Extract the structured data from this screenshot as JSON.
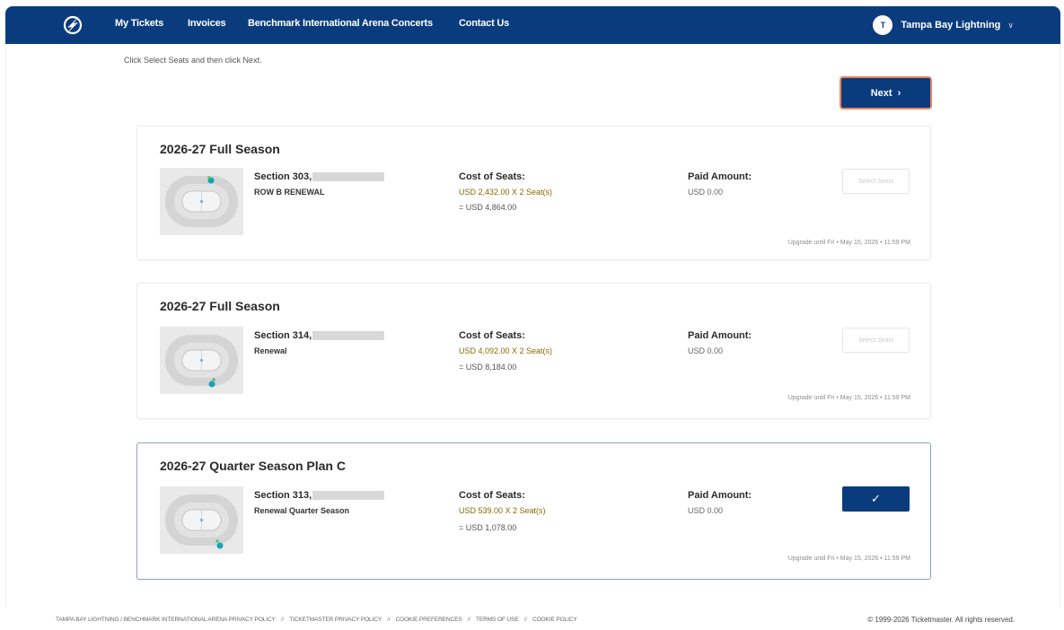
{
  "nav": {
    "items": [
      "My Tickets",
      "Invoices",
      "Benchmark International Arena Concerts",
      "Contact Us"
    ],
    "account_initial": "T",
    "account_name": "Tampa Bay Lightning"
  },
  "instruction": "Click Select Seats and then click Next.",
  "next_label": "Next",
  "labels": {
    "cost": "Cost of Seats:",
    "paid": "Paid Amount:",
    "select_seats": "Select Seats"
  },
  "cards": [
    {
      "title": "2026-27 Full Season",
      "section": "Section 303,",
      "row": "ROW B RENEWAL",
      "cost_line": "USD 2,432.00 X 2 Seat(s)",
      "total_line": "= USD 4,864.00",
      "paid_amount": "USD 0.00",
      "upgrade": "Upgrade until Fri • May 15, 2026 • 11:59 PM",
      "selected": false
    },
    {
      "title": "2026-27 Full Season",
      "section": "Section 314,",
      "row": "Renewal",
      "cost_line": "USD 4,092.00 X 2 Seat(s)",
      "total_line": "= USD 8,184.00",
      "paid_amount": "USD 0.00",
      "upgrade": "Upgrade until Fri • May 15, 2026 • 11:59 PM",
      "selected": false
    },
    {
      "title": "2026-27 Quarter Season Plan C",
      "section": "Section 313,",
      "row": "Renewal Quarter Season",
      "cost_line": "USD 539.00 X 2 Seat(s)",
      "total_line": "= USD 1,078.00",
      "paid_amount": "USD 0.00",
      "upgrade": "Upgrade until Fri • May 15, 2026 • 11:59 PM",
      "selected": true
    }
  ],
  "footer": {
    "links": [
      "TAMPA BAY LIGHTNING / BENCHMARK INTERNATIONAL ARENA PRIVACY POLICY",
      "TICKETMASTER PRIVACY POLICY",
      "COOKIE PREFERENCES",
      "TERMS OF USE",
      "COOKIE POLICY"
    ],
    "separator": "//",
    "copyright": "© 1999-2026 Ticketmaster. All rights reserved."
  },
  "colors": {
    "nav_bg": "#0a3c7d",
    "next_border": "#e8845a",
    "price_text": "#8a6a00",
    "seat_marker": "#17a2b8"
  }
}
